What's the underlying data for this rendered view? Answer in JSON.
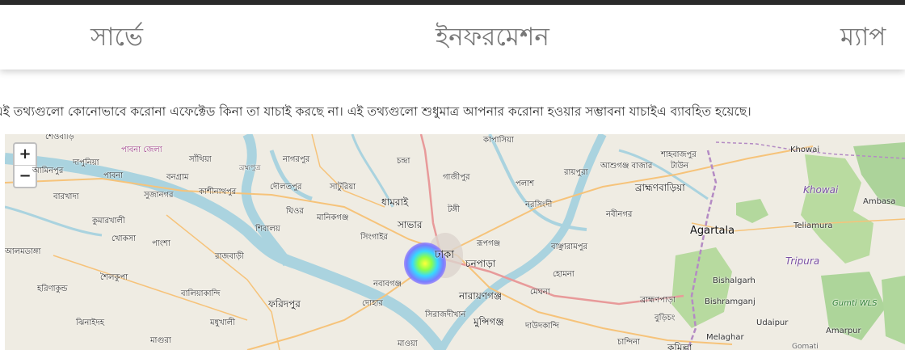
{
  "nav": {
    "survey": "সার্ভে",
    "information": "ইনফরমেশন",
    "map": "ম্যাপ"
  },
  "disclaimer": "এই তথ্যগুলো কোনোভাবে করোনা এফেক্টেড কিনা তা যাচাই করছে না। এই তথ্যগুলো শুধুমাত্র আপনার করোনা হওয়ার সম্ভাবনা যাচাইএ ব্যাবহিত হয়েছে।",
  "map": {
    "zoom_in": "+",
    "zoom_out": "−",
    "labels": {
      "sheobari": "শেওবাড়ি",
      "pabna_district": "পাবনা জেলা",
      "sathia": "সাঁথিয়া",
      "nagarpur": "নাগরপুর",
      "chandra": "চন্দ্রা",
      "kapasia": "কাপাসিয়া",
      "shahbajpur": "শাহবাজপুর",
      "khowai": "Khowai",
      "dapunia": "দাপুনিয়া",
      "aminpur": "আমিনপুর",
      "brahmaputra": "ব্রহ্মপুত্র",
      "gazipur": "গাজীপুর",
      "raypura": "রায়পুরা",
      "ashuganj": "আশুগঞ্জ বাজার",
      "taun": "টাউন",
      "chhatra": "ছাতরা",
      "pabna": "পাবনা",
      "bonogram": "বনগ্রাম",
      "daulatpur": "দৌলতপুর",
      "saturia": "সাটুরিয়া",
      "palash": "পলাশ",
      "brahmanbaria": "ব্রাহ্মণবাড়িয়া",
      "khowai2": "Khowai",
      "barkhada": "বারখাদা",
      "sujanagar": "সুজানগর",
      "kashinathpur": "কাশীনাথপুর",
      "dhamrai": "ধামরাই",
      "tongi": "টঙ্গী",
      "narsingdi": "নরসিংদী",
      "ambasa": "Ambasa",
      "ghior": "ঘিওর",
      "manikganj": "মানিকগঞ্জ",
      "kumarkhali": "কুমারখালী",
      "savar": "সাভার",
      "nabinagar": "নবীনগর",
      "khoksa": "খোকসা",
      "shibalaya": "শিবালয়",
      "singair": "সিংগাইর",
      "agartala": "Agartala",
      "teliamura": "Teliamura",
      "pangsha": "পাংশা",
      "rupganj": "রূপগঞ্জ",
      "banchharampur": "বাঞ্ছারামপুর",
      "dhaka": "ঢাকা",
      "alamdanga": "আলমডাঙ্গা",
      "rajbari": "রাজবাড়ী",
      "chanpara": "চনপাড়া",
      "tripura": "Tripura",
      "homna": "হোমনা",
      "shailkupa": "শৈলকুপা",
      "nawabganj": "নবাবগঞ্জ",
      "bishalgarh": "Bishalgarh",
      "harinakunda": "হরিণাকুন্ড",
      "baliakandi": "বালিয়াকান্দি",
      "narayanganj": "নারায়ণগঞ্জ",
      "meghna": "মেঘনা",
      "brahmanpara": "ব্রাহ্মণপাড়া",
      "bishramganj": "Bishramganj",
      "gumti_wls": "Gumti WLS",
      "faridpur": "ফরিদপুর",
      "dohar": "দোহার",
      "burichang": "বুড়িচং",
      "sirajdikhan": "সিরাজদীখান",
      "udaipur": "Udaipur",
      "jhenaidah": "ঝিনাইদহ",
      "madhukhali": "মধুখালী",
      "munshiganj": "মুন্সিগঞ্জ",
      "daudkandi": "দাউদকান্দি",
      "amarpur": "Amarpur",
      "melaghar": "Melaghar",
      "magura": "মাগুরা",
      "mawa": "মাওয়া",
      "chandina": "চান্দিনা",
      "cumilla": "কুমিল্লা",
      "gomati": "Gomati"
    }
  }
}
